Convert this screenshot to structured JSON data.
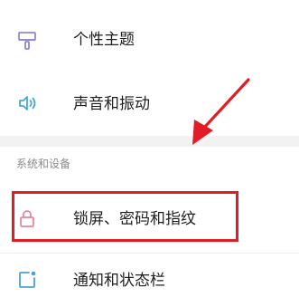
{
  "settings": {
    "items": [
      {
        "label": "个性主题",
        "icon": "theme-icon"
      },
      {
        "label": "声音和振动",
        "icon": "speaker-icon"
      }
    ],
    "section_header": "系统和设备",
    "section_items": [
      {
        "label": "锁屏、密码和指纹",
        "icon": "lock-icon"
      },
      {
        "label": "通知和状态栏",
        "icon": "notification-icon"
      }
    ]
  },
  "annotation": {
    "color": "#e11c24",
    "highlighted_item": "锁屏、密码和指纹"
  },
  "colors": {
    "theme_icon": "#8f87d8",
    "sound_icon": "#4aa8cf",
    "lock_icon": "#e8859e",
    "notification_icon": "#4e9fd8",
    "section_background": "#f2f2f2"
  }
}
